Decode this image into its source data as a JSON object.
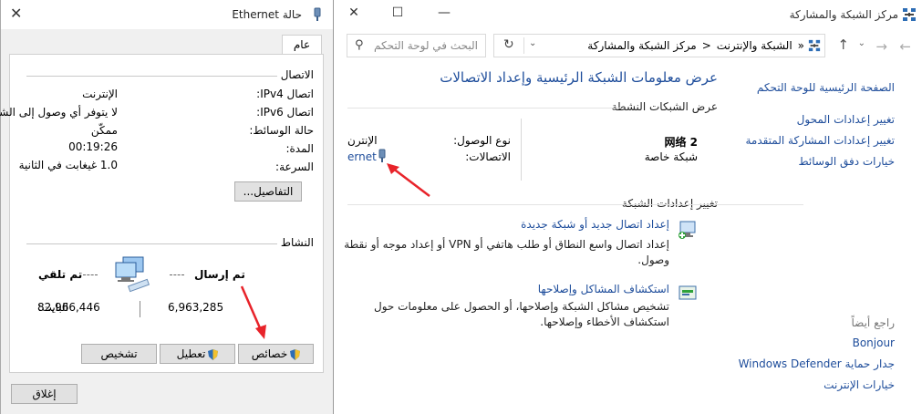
{
  "control_panel": {
    "window_title": "مركز الشبكة والمشاركة",
    "breadcrumb": [
      "الشبكة والإنترنت",
      "مركز الشبكة والمشاركة"
    ],
    "breadcrumb_prefix": "«",
    "search_placeholder": "البحث في لوحة التحكم",
    "sidebar": {
      "home": "الصفحة الرئيسية للوحة التحكم",
      "links": [
        "تغيير إعدادات المحول",
        "تغيير إعدادات المشاركة المتقدمة",
        "خيارات دفق الوسائط"
      ],
      "see_also_title": "راجع أيضاً",
      "see_also": [
        "Bonjour",
        "جدار حماية Windows Defender",
        "خيارات الإنترنت"
      ]
    },
    "main_title": "عرض معلومات الشبكة الرئيسية وإعداد الاتصالات",
    "active_networks_title": "عرض الشبكات النشطة",
    "network": {
      "name": "网络 2",
      "type": "شبكة خاصة",
      "access_label": "نوع الوصول:",
      "access_value": "الإنترن",
      "connections_label": "الاتصالات:",
      "connections_value": "ernet"
    },
    "change_settings_title": "تغيير إعدادات الشبكة",
    "tasks": [
      {
        "link": "إعداد اتصال جديد أو شبكة جديدة",
        "desc": "إعداد اتصال واسع النطاق أو طلب هاتفي أو VPN أو إعداد موجه أو نقطة وصول."
      },
      {
        "link": "استكشاف المشاكل وإصلاحها",
        "desc": "تشخيص مشاكل الشبكة وإصلاحها، أو الحصول على معلومات حول استكشاف الأخطاء وإصلاحها."
      }
    ]
  },
  "ethernet_dialog": {
    "title": "حالة Ethernet",
    "tab": "عام",
    "connection_group": "الاتصال",
    "fields": [
      {
        "label": "اتصال IPv4:",
        "value": "الإنترنت"
      },
      {
        "label": "اتصال IPv6:",
        "value": "لا يتوفر أي وصول إلى الشبكة"
      },
      {
        "label": "حالة الوسائط:",
        "value": "ممكّن"
      },
      {
        "label": "المدة:",
        "value": "00:19:26"
      },
      {
        "label": "السرعة:",
        "value": "1.0 غيغابت في الثانية"
      }
    ],
    "details_button": "التفاصيل...",
    "activity_group": "النشاط",
    "sent_label": "تم إرسال",
    "received_label": "تم تلقي",
    "bytes_label": "البايت:",
    "bytes_sent": "6,963,285",
    "bytes_received": "82,966,446",
    "properties_button": "خصائص",
    "disable_button": "تعطيل",
    "diagnose_button": "تشخيص",
    "close_button": "إغلاق"
  },
  "colors": {
    "link": "#1e4d9b",
    "annotation_arrow": "#e8232a",
    "dialog_bg": "#f0f0f0"
  }
}
